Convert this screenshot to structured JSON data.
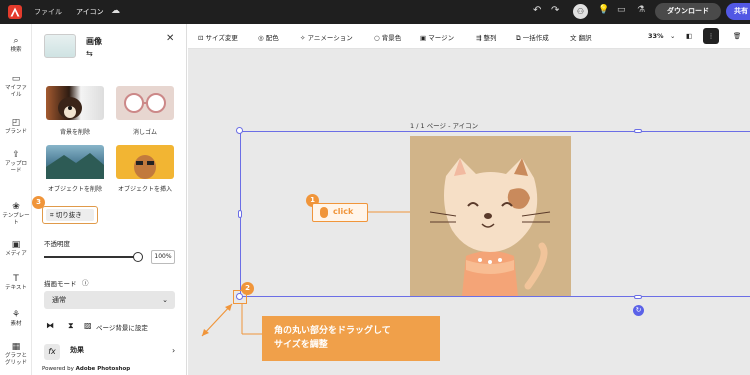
{
  "topbar": {
    "file_label": "ファイル",
    "doc_name": "アイコン",
    "download_label": "ダウンロード",
    "share_label": "共有"
  },
  "rail": [
    {
      "label": "検索",
      "icon": "search-icon"
    },
    {
      "label": "マイファイル",
      "icon": "folder-icon"
    },
    {
      "label": "ブランド",
      "icon": "brand-icon"
    },
    {
      "label": "アップロード",
      "icon": "upload-icon"
    },
    {
      "label": "テンプレート",
      "icon": "template-icon"
    },
    {
      "label": "メディア",
      "icon": "media-icon"
    },
    {
      "label": "テキスト",
      "icon": "text-icon"
    },
    {
      "label": "素材",
      "icon": "elements-icon"
    },
    {
      "label": "グラフとグリッド",
      "icon": "chart-icon"
    }
  ],
  "panel": {
    "title": "画像",
    "quick_actions": [
      {
        "label": "背景を削除"
      },
      {
        "label": "消しゴム"
      },
      {
        "label": "オブジェクトを削除"
      },
      {
        "label": "オブジェクトを挿入"
      }
    ],
    "crop_label": "切り抜き",
    "opacity_label": "不透明度",
    "opacity_value": "100%",
    "opacity_fraction": 1.0,
    "blend_label": "描画モード",
    "blend_value": "通常",
    "page_bg_label": "ページ背景に設定",
    "effects_label": "効果",
    "powered_prefix": "Powered by ",
    "powered_brand": "Adobe Photoshop"
  },
  "toolbar": {
    "items": [
      "サイズ変更",
      "配色",
      "アニメーション",
      "背景色",
      "マージン",
      "整列",
      "一括作成",
      "翻訳"
    ],
    "zoom": "33%"
  },
  "canvas": {
    "page_label": "1 / 1 ページ - アイコン"
  },
  "annotations": {
    "badge1": "1",
    "badge2": "2",
    "badge3": "3",
    "click_text": "click",
    "tip_line1": "角の丸い部分をドラッグして",
    "tip_line2": "サイズを調整"
  },
  "colors": {
    "accent": "#5b62e8",
    "annotation": "#f0953a",
    "topbar": "#1f1f1f"
  }
}
